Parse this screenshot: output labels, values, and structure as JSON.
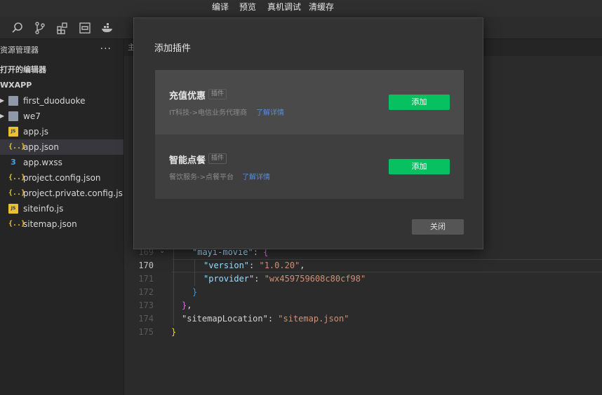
{
  "menu": [
    "编译",
    "预览",
    "真机调试",
    "清缓存"
  ],
  "toolbar_icons": [
    "search-icon",
    "source-control-icon",
    "extensions-icon",
    "debug-icon",
    "docker-icon"
  ],
  "sidebar": {
    "title": "资源管理器",
    "more": "···",
    "open_editors": "打开的编辑器",
    "project": "WXAPP",
    "items": [
      {
        "label": "first_duoduoke",
        "icon": "folder-icon",
        "expandable": true
      },
      {
        "label": "we7",
        "icon": "folder-icon",
        "expandable": true
      },
      {
        "label": "app.js",
        "icon": "js-file-icon",
        "badge": "JS"
      },
      {
        "label": "app.json",
        "icon": "json-file-icon",
        "badge": "{..}",
        "selected": true
      },
      {
        "label": "app.wxss",
        "icon": "css-file-icon",
        "badge": "3"
      },
      {
        "label": "project.config.json",
        "icon": "json-file-icon",
        "badge": "{..}"
      },
      {
        "label": "project.private.config.js...",
        "icon": "json-file-icon",
        "badge": "{..}"
      },
      {
        "label": "siteinfo.js",
        "icon": "js-file-icon",
        "badge": "JS"
      },
      {
        "label": "sitemap.json",
        "icon": "json-file-icon",
        "badge": "{..}"
      }
    ]
  },
  "editor": {
    "tab_label": "主",
    "line_numbers": [
      "169",
      "170",
      "171",
      "172",
      "173",
      "174",
      "175"
    ],
    "active_line": "170",
    "code": {
      "l169_key": "\"mayi-movie\"",
      "l169_colon": ": ",
      "l169_brace": "{",
      "l170_key": "\"version\"",
      "l170_colon": ": ",
      "l170_val": "\"1.0.20\"",
      "l170_comma": ",",
      "l171_key": "\"provider\"",
      "l171_colon": ": ",
      "l171_val": "\"wx459759608c80cf98\"",
      "l172_brace": "}",
      "l173_brace": "}",
      "l173_comma": ",",
      "l174_key": "\"sitemapLocation\"",
      "l174_colon": ": ",
      "l174_val": "\"sitemap.json\"",
      "l175_brace": "}"
    }
  },
  "modal": {
    "title": "添加插件",
    "plugins": [
      {
        "name": "充值优惠",
        "tag": "插件",
        "desc": "IT科技->电信业务代理商",
        "link": "了解详情",
        "button": "添加"
      },
      {
        "name": "智能点餐",
        "tag": "插件",
        "desc": "餐饮服务->点餐平台",
        "link": "了解详情",
        "button": "添加"
      }
    ],
    "close_button": "关闭"
  },
  "colors": {
    "accent_green": "#07c160",
    "link_blue": "#5a8bd6",
    "json_icon_yellow": "#e8c233",
    "css_icon_blue": "#4aa2e0"
  }
}
